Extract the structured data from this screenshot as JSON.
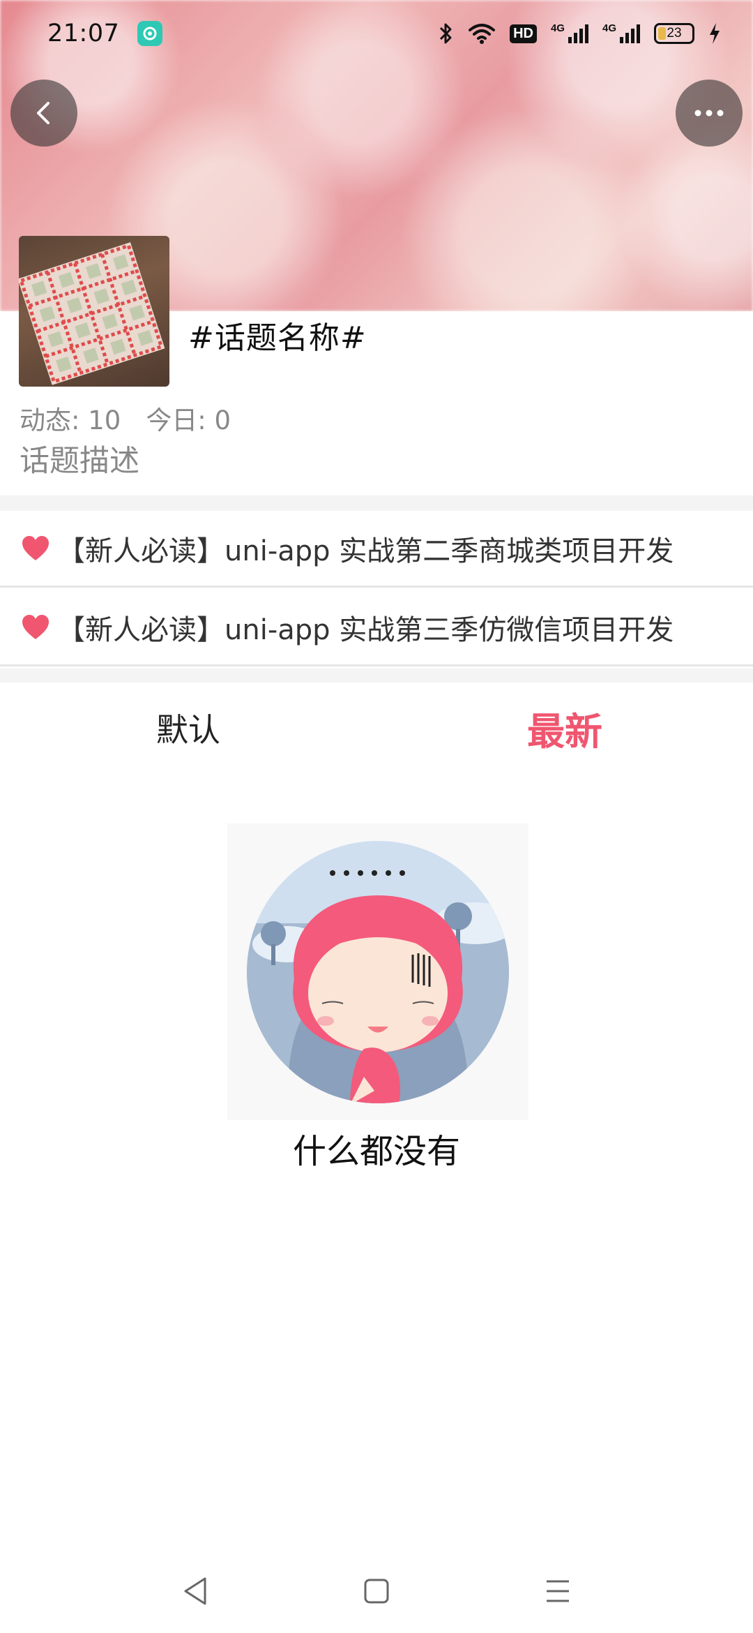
{
  "status_bar": {
    "time": "21:07",
    "hd_label": "HD",
    "network_1": "4G",
    "network_2": "4G",
    "battery_level": "23",
    "battery_fraction": 0.23
  },
  "icons": {
    "back": "chevron-left-icon",
    "more": "more-dots-icon",
    "bluetooth": "bluetooth-icon",
    "wifi": "wifi-icon",
    "signal": "signal-icon",
    "charging": "charging-bolt-icon",
    "heart": "heart-icon",
    "nav_back": "triangle-back-icon",
    "nav_home": "square-home-icon",
    "nav_menu": "menu-lines-icon"
  },
  "topic": {
    "title": "#话题名称#",
    "stats_posts": "动态: 10",
    "stats_today": "今日: 0",
    "description": "话题描述"
  },
  "pinned": [
    {
      "text": "【新人必读】uni-app 实战第二季商城类项目开发"
    },
    {
      "text": "【新人必读】uni-app 实战第三季仿微信项目开发"
    }
  ],
  "tabs": [
    {
      "label": "默认",
      "active": false
    },
    {
      "label": "最新",
      "active": true
    }
  ],
  "empty_state": {
    "text": "什么都没有"
  },
  "colors": {
    "accent": "#f0566f",
    "heart": "#f0566f",
    "muted_text": "#888888"
  }
}
